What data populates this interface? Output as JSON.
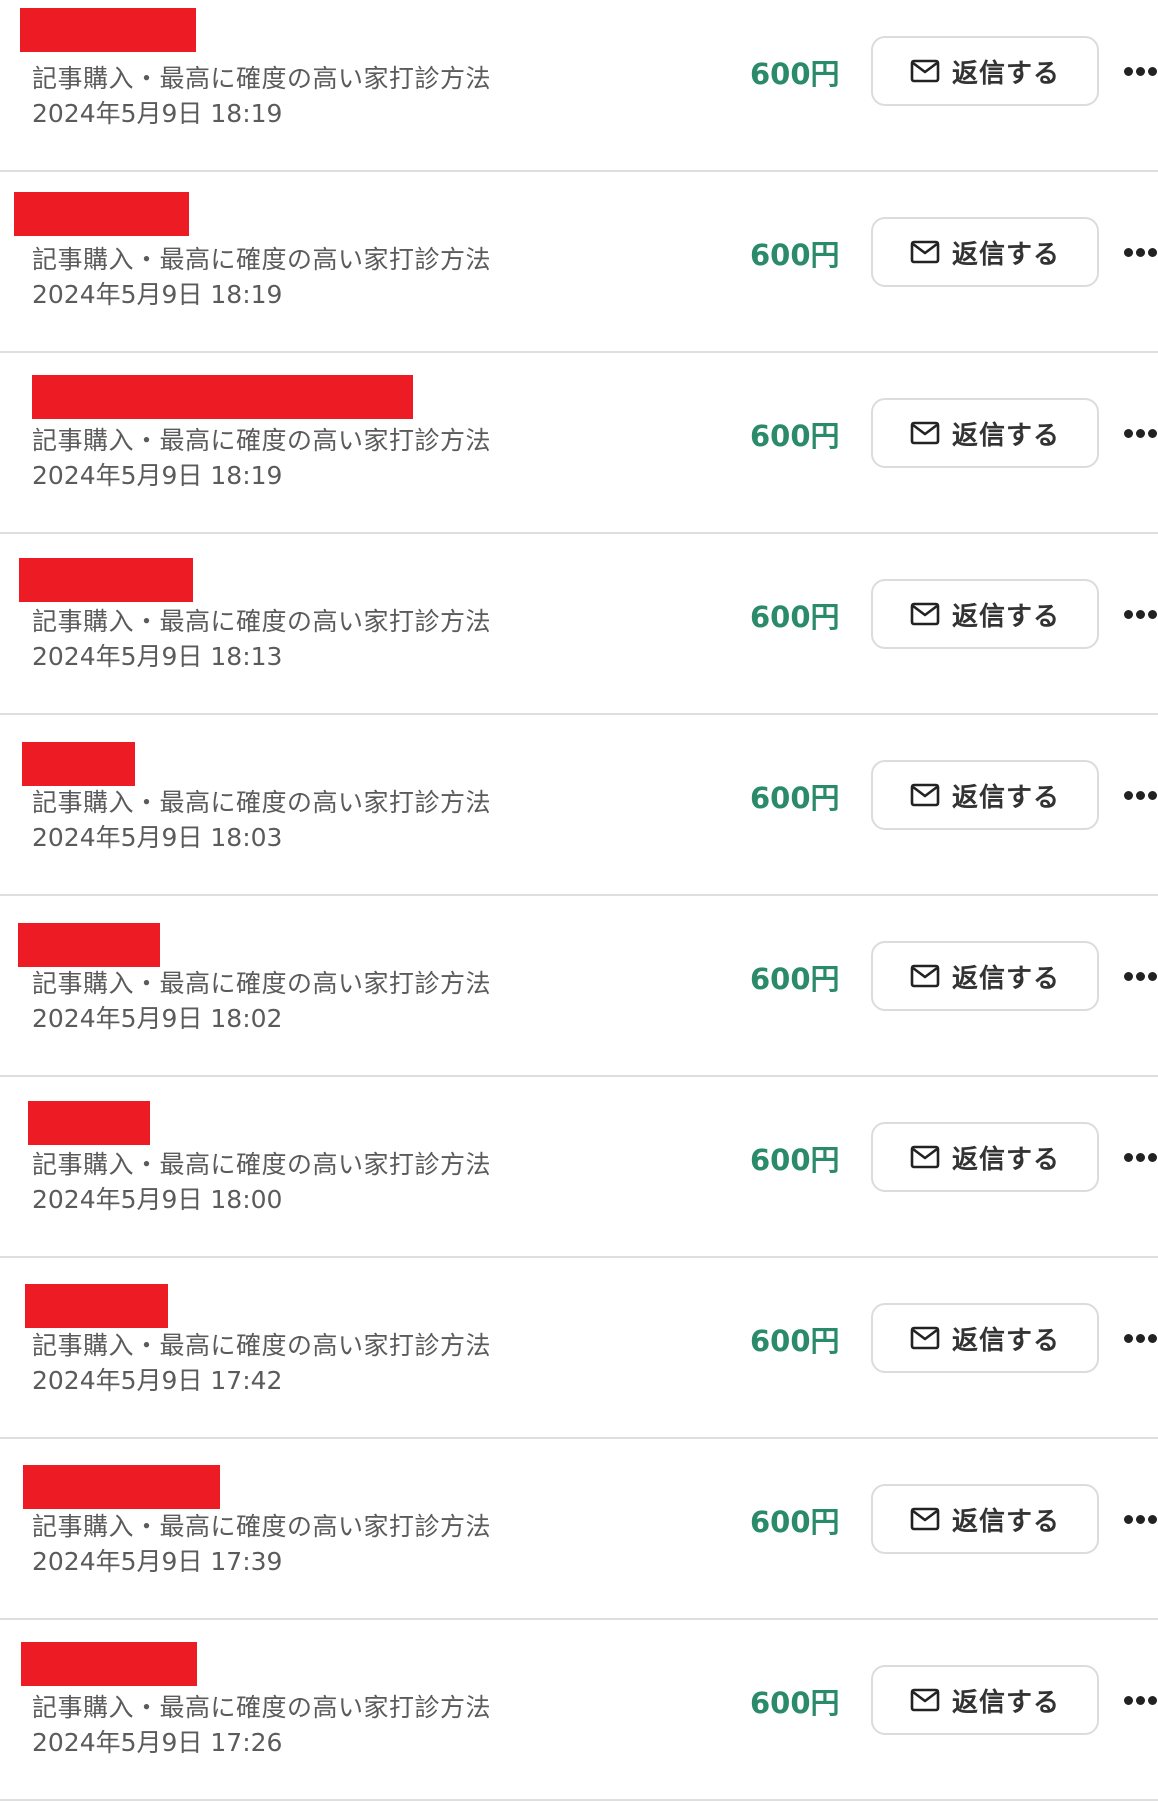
{
  "colors": {
    "price": "#2a8a6a",
    "redaction": "#ed1c24",
    "divider": "#dedede"
  },
  "icons": {
    "reply": "envelope-icon",
    "more": "more-horizontal-icon"
  },
  "purchases": [
    {
      "title": "記事購入・最高に確度の高い家打診方法",
      "date": "2024年5月9日 18:19",
      "price": "600円",
      "reply_label": "返信する"
    },
    {
      "title": "記事購入・最高に確度の高い家打診方法",
      "date": "2024年5月9日 18:19",
      "price": "600円",
      "reply_label": "返信する"
    },
    {
      "title": "記事購入・最高に確度の高い家打診方法",
      "date": "2024年5月9日 18:19",
      "price": "600円",
      "reply_label": "返信する"
    },
    {
      "title": "記事購入・最高に確度の高い家打診方法",
      "date": "2024年5月9日 18:13",
      "price": "600円",
      "reply_label": "返信する"
    },
    {
      "title": "記事購入・最高に確度の高い家打診方法",
      "date": "2024年5月9日 18:03",
      "price": "600円",
      "reply_label": "返信する"
    },
    {
      "title": "記事購入・最高に確度の高い家打診方法",
      "date": "2024年5月9日 18:02",
      "price": "600円",
      "reply_label": "返信する"
    },
    {
      "title": "記事購入・最高に確度の高い家打診方法",
      "date": "2024年5月9日 18:00",
      "price": "600円",
      "reply_label": "返信する"
    },
    {
      "title": "記事購入・最高に確度の高い家打診方法",
      "date": "2024年5月9日 17:42",
      "price": "600円",
      "reply_label": "返信する"
    },
    {
      "title": "記事購入・最高に確度の高い家打診方法",
      "date": "2024年5月9日 17:39",
      "price": "600円",
      "reply_label": "返信する"
    },
    {
      "title": "記事購入・最高に確度の高い家打診方法",
      "date": "2024年5月9日 17:26",
      "price": "600円",
      "reply_label": "返信する"
    }
  ]
}
